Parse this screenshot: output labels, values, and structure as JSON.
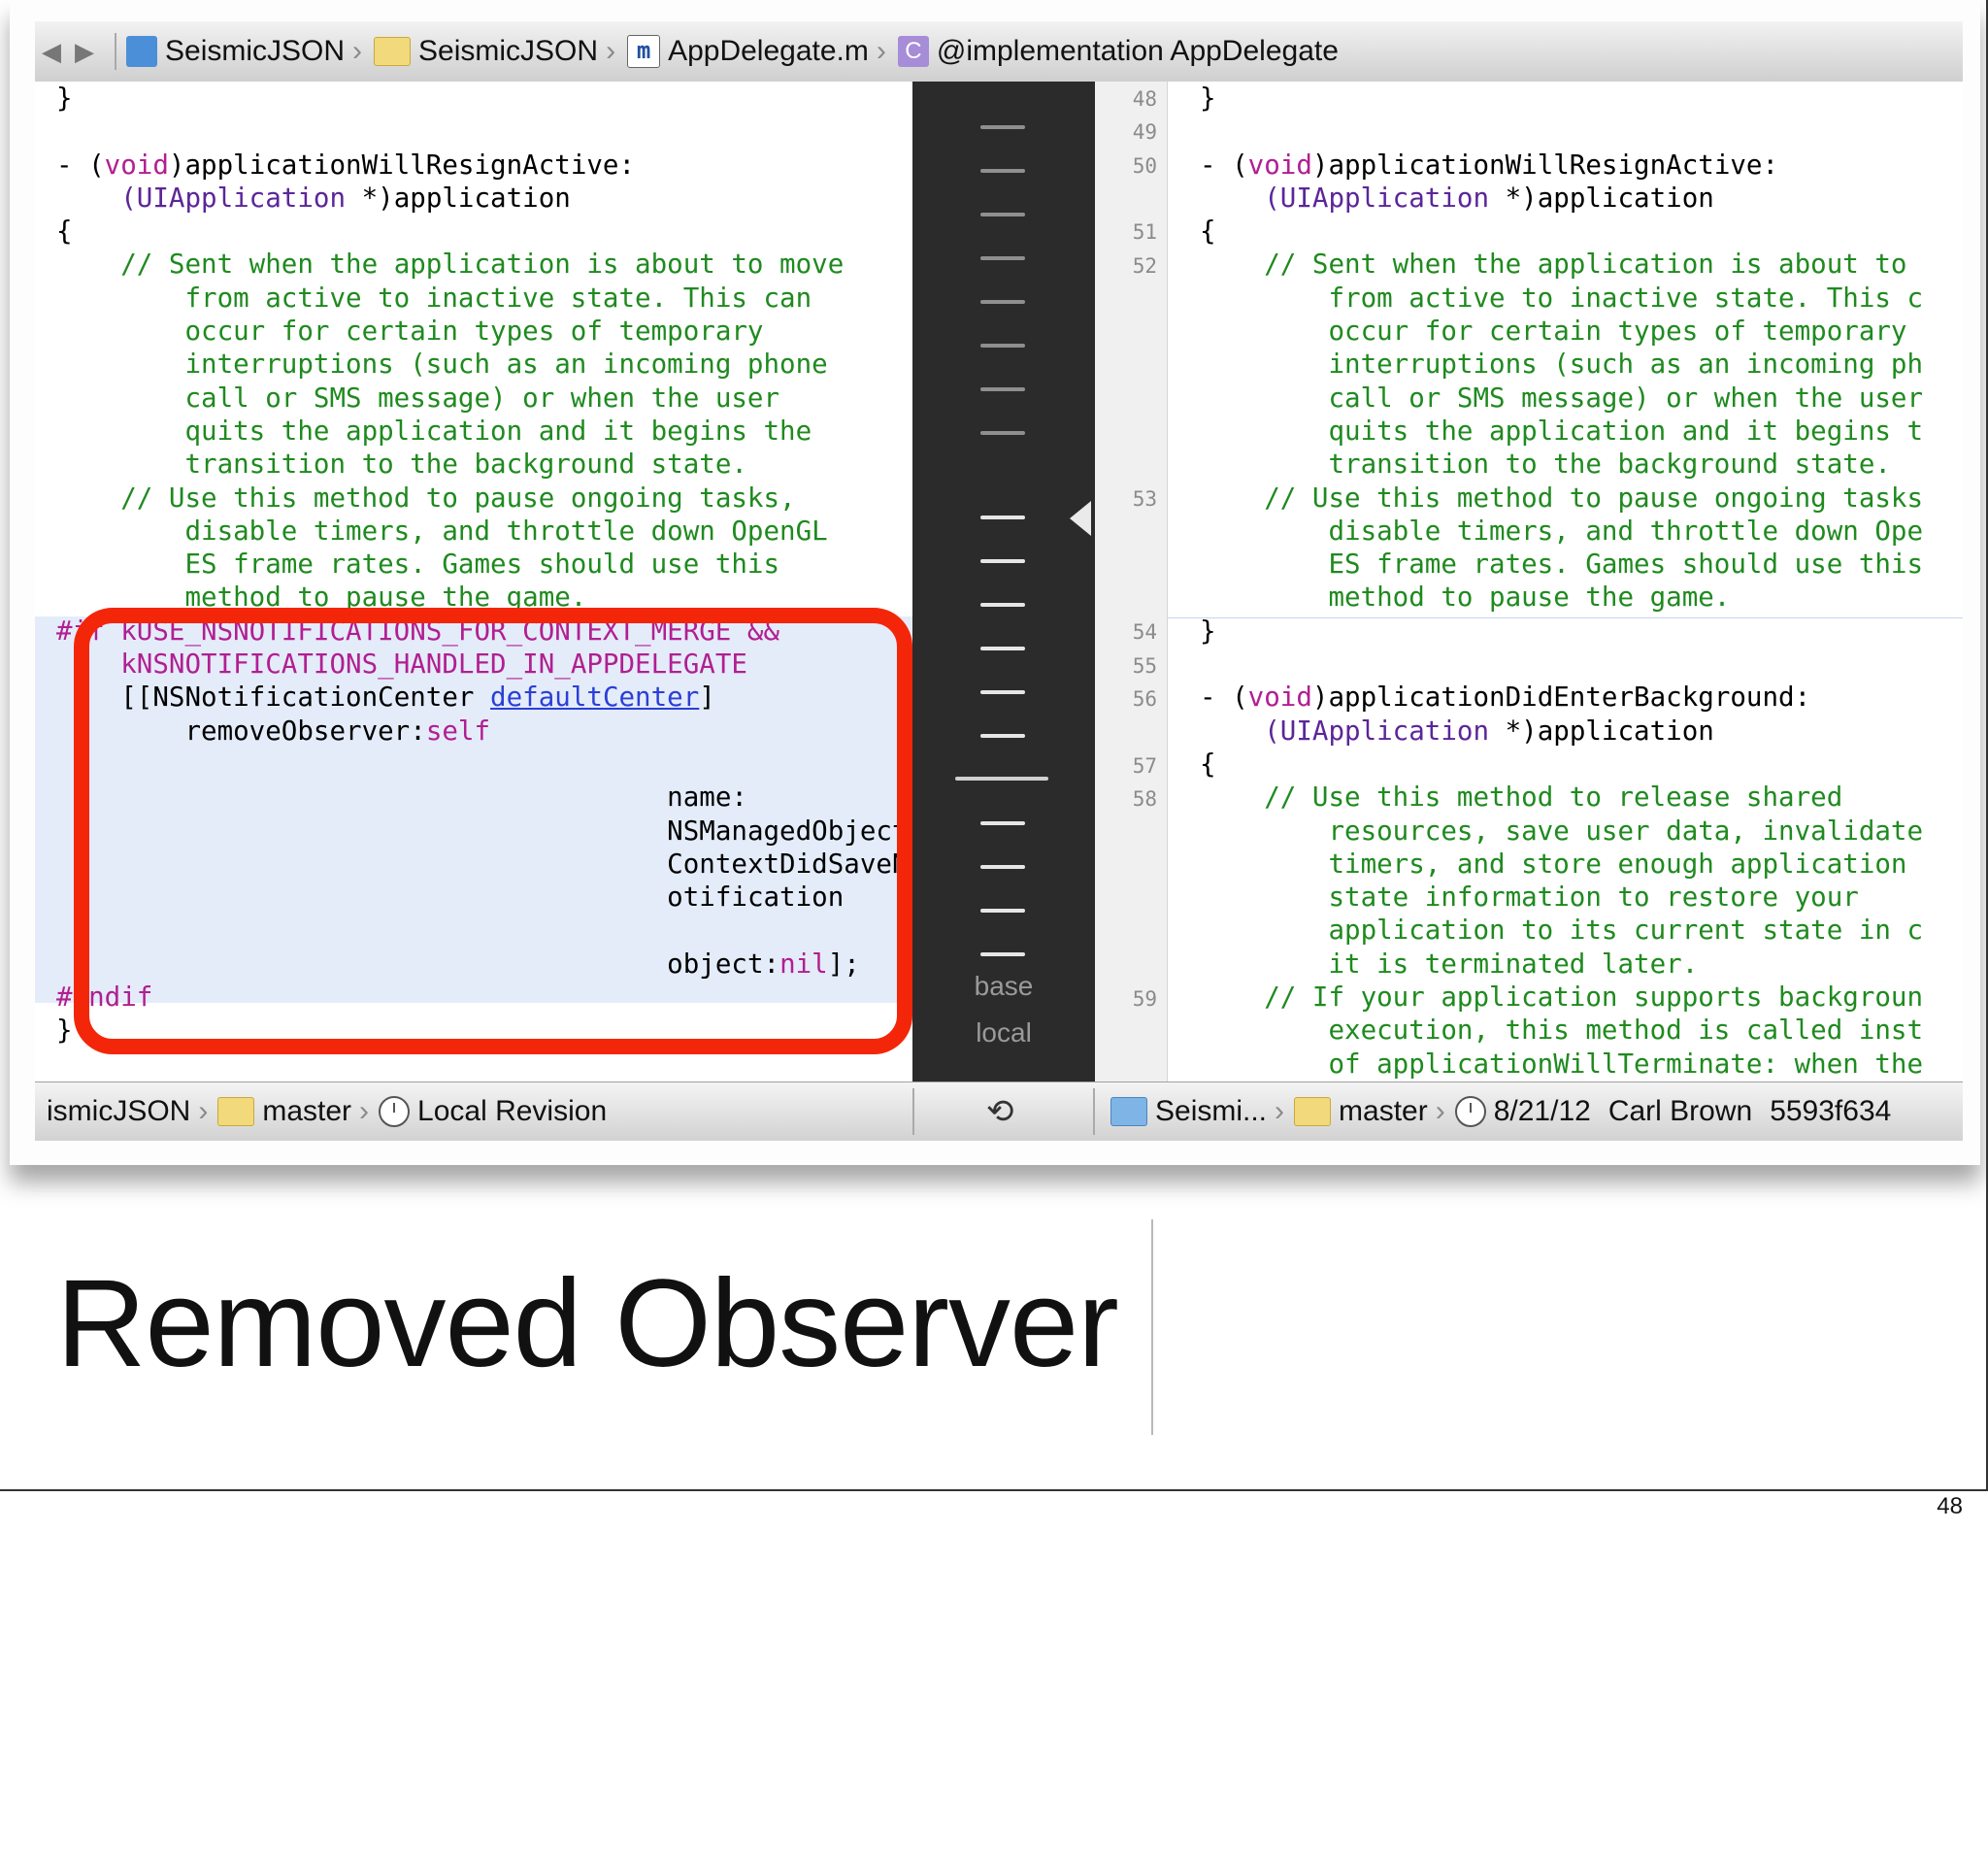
{
  "jumpbar": {
    "crumbs": [
      "SeismicJSON",
      "SeismicJSON",
      "AppDelegate.m",
      "@implementation AppDelegate"
    ],
    "icons": [
      "project-icon",
      "folder-icon",
      "m-file-icon",
      "class-icon"
    ],
    "mfile_glyph": "m",
    "class_glyph": "C"
  },
  "left_code": {
    "l01": "}",
    "l03a": "- (",
    "l03kw": "void",
    "l03b": ")applicationWillResignActive:",
    "l04ty": "(UIApplication",
    "l04b": " *)application",
    "l05": "{",
    "c01": "// Sent when the application is about to move",
    "c02": "from active to inactive state. This can",
    "c03": "occur for certain types of temporary",
    "c04": "interruptions (such as an incoming phone",
    "c05": "call or SMS message) or when the user",
    "c06": "quits the application and it begins the",
    "c07": "transition to the background state.",
    "c08": "// Use this method to pause ongoing tasks,",
    "c09": "disable timers, and throttle down OpenGL",
    "c10": "ES frame rates. Games should use this",
    "c11": "method to pause the game.",
    "p01": "#if kUSE_NSNOTIFICATIONS_FOR_CONTEXT_MERGE &&",
    "p02": "kNSNOTIFICATIONS_HANDLED_IN_APPDELEGATE",
    "k01a": "[[NSNotificationCenter ",
    "k01link": "defaultCenter",
    "k01b": "]",
    "k02a": "removeObserver:",
    "k02kw": "self",
    "k03": "name:",
    "k04": "NSManagedObject",
    "k05": "ContextDidSaveN",
    "k06": "otification",
    "k07a": "object:",
    "k07kw": "nil",
    "k07b": "];",
    "p03": "#endif",
    "l99": "}"
  },
  "right_code": {
    "line_numbers": [
      "48",
      "49",
      "50",
      "51",
      "52",
      "53",
      "54",
      "55",
      "56",
      "57",
      "58",
      "59"
    ],
    "r01": "}",
    "r03a": "- (",
    "r03kw": "void",
    "r03b": ")applicationWillResignActive:",
    "r04ty": "(UIApplication",
    "r04b": " *)application",
    "r05": "{",
    "c01": "// Sent when the application is about to",
    "c02": "from active to inactive state. This c",
    "c03": "occur for certain types of temporary",
    "c04": "interruptions (such as an incoming ph",
    "c05": "call or SMS message) or when the user",
    "c06": "quits the application and it begins t",
    "c07": "transition to the background state.",
    "c08": "// Use this method to pause ongoing tasks",
    "c09": "disable timers, and throttle down Ope",
    "c10": "ES frame rates. Games should use this",
    "c11": "method to pause the game.",
    "r14": "}",
    "r16a": "- (",
    "r16kw": "void",
    "r16b": ")applicationDidEnterBackground:",
    "r17ty": "(UIApplication",
    "r17b": " *)application",
    "r18": "{",
    "d01": "// Use this method to release shared",
    "d02": "resources, save user data, invalidate",
    "d03": "timers, and store enough application",
    "d04": "state information to restore your",
    "d05": "application to its current state in c",
    "d06": "it is terminated later.",
    "d07": "// If your application supports backgroun",
    "d08": "execution, this method is called inst",
    "d09": "of applicationWillTerminate: when the"
  },
  "timeline": {
    "base_label": "base",
    "local_label": "local"
  },
  "bottom": {
    "left_crumb": "ismicJSON",
    "left_branch": "master",
    "left_revision": "Local Revision",
    "right_crumb": "Seismi...",
    "right_branch": "master",
    "right_date": "8/21/12",
    "right_author": "Carl Brown",
    "right_commit": "5593f634"
  },
  "slide": {
    "title": "Removed Observer",
    "page_number": "48",
    "highlight_color": "#f4260a"
  }
}
